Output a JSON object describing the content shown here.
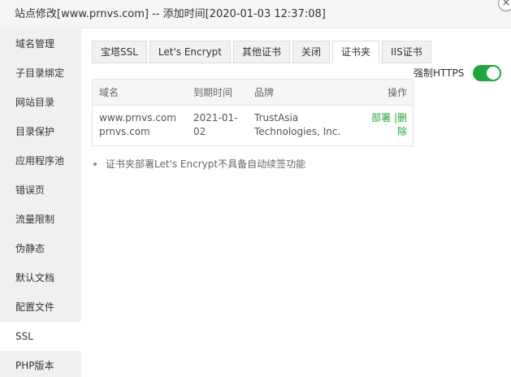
{
  "title": "站点修改[www.prnvs.com] -- 添加时间[2020-01-03 12:37:08]",
  "sidebar": {
    "items": [
      {
        "label": "域名管理"
      },
      {
        "label": "子目录绑定"
      },
      {
        "label": "网站目录"
      },
      {
        "label": "目录保护"
      },
      {
        "label": "应用程序池"
      },
      {
        "label": "错误页"
      },
      {
        "label": "流量限制"
      },
      {
        "label": "伪静态"
      },
      {
        "label": "默认文档"
      },
      {
        "label": "配置文件"
      },
      {
        "label": "SSL"
      },
      {
        "label": "PHP版本"
      }
    ],
    "active": "SSL"
  },
  "tabs": [
    {
      "label": "宝塔SSL"
    },
    {
      "label": "Let's Encrypt"
    },
    {
      "label": "其他证书"
    },
    {
      "label": "关闭"
    },
    {
      "label": "证书夹"
    },
    {
      "label": "IIS证书"
    }
  ],
  "active_tab": "证书夹",
  "https": {
    "label": "强制HTTPS",
    "enabled": true
  },
  "table": {
    "headers": {
      "domain": "域名",
      "expiry": "到期时间",
      "brand": "品牌",
      "action": "操作"
    },
    "rows": [
      {
        "domain_line1": "www.prnvs.com",
        "domain_line2": "prnvs.com",
        "expiry_line1": "2021-01-",
        "expiry_line2": "02",
        "brand_line1": "TrustAsia",
        "brand_line2": "Technologies, Inc.",
        "deploy": "部署",
        "separator": "|",
        "delete_part1": "删",
        "delete_part2": "除"
      }
    ]
  },
  "note": "证书夹部署Let's Encrypt不具备自动续签功能",
  "colors": {
    "accent": "#20a53a"
  }
}
